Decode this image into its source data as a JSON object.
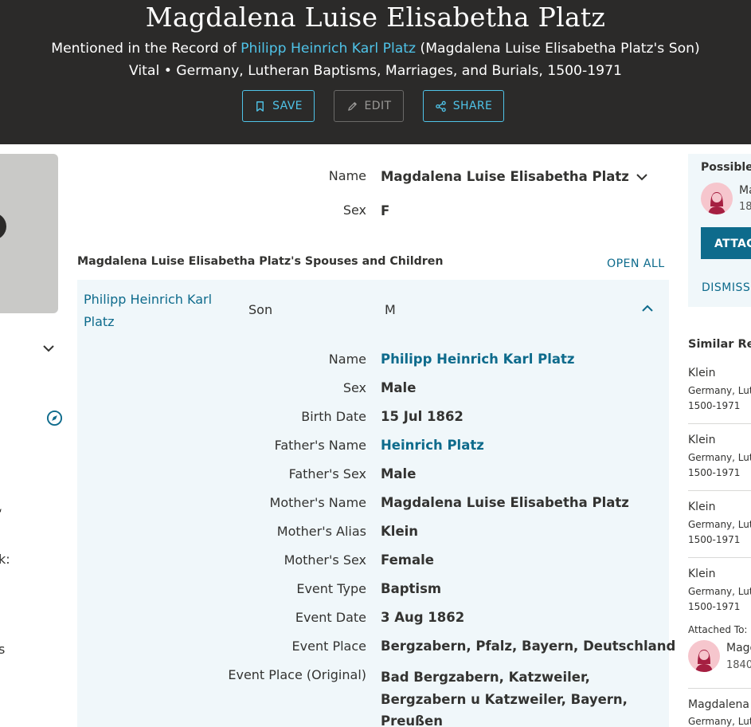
{
  "hero": {
    "title": "Magdalena Luise Elisabetha Platz",
    "mention_prefix": "Mentioned in the Record of",
    "mention_link": "Philipp Heinrich Karl Platz",
    "mention_suffix": "(Magdalena Luise Elisabetha Platz's Son)",
    "vital_line": "Vital • Germany, Lutheran Baptisms, Marriages, and Burials, 1500-1971",
    "buttons": {
      "save": "SAVE",
      "edit": "EDIT",
      "share": "SHARE"
    }
  },
  "left_partial": {
    "frag1": "‘",
    "frag2": "k:",
    "frag3": "s"
  },
  "person": {
    "name_label": "Name",
    "name_value": "Magdalena Luise Elisabetha Platz",
    "sex_label": "Sex",
    "sex_value": "F"
  },
  "family": {
    "section_title": "Magdalena Luise Elisabetha Platz's Spouses and Children",
    "open_all": "OPEN ALL",
    "relative": {
      "name": "Philipp Heinrich Karl Platz",
      "role": "Son",
      "sex": "M",
      "details": [
        {
          "label": "Name",
          "value": "Philipp Heinrich Karl Platz"
        },
        {
          "label": "Sex",
          "value": "Male"
        },
        {
          "label": "Birth Date",
          "value": "15 Jul 1862"
        },
        {
          "label": "Father's Name",
          "value": "Heinrich Platz"
        },
        {
          "label": "Father's Sex",
          "value": "Male"
        },
        {
          "label": "Mother's Name",
          "value": "Magdalena Luise Elisabetha Platz"
        },
        {
          "label": "Mother's Alias",
          "value": "Klein"
        },
        {
          "label": "Mother's Sex",
          "value": "Female"
        },
        {
          "label": "Event Type",
          "value": "Baptism"
        },
        {
          "label": "Event Date",
          "value": "3 Aug 1862"
        },
        {
          "label": "Event Place",
          "value": "Bergzabern, Pfalz, Bayern, Deutschland"
        },
        {
          "label": "Event Place (Original)",
          "value": "Bad Bergzabern, Katzweiler, Bergzabern u Katzweiler, Bayern, Preußen"
        }
      ]
    }
  },
  "possible_match": {
    "title": "Possible",
    "name": "Ma",
    "years": "18",
    "attach": "ATTACH",
    "dismiss": "DISMISS"
  },
  "similar": {
    "title": "Similar Re",
    "items": [
      {
        "name": "Klein",
        "line1": "Germany, Lut",
        "line2": "1500-1971"
      },
      {
        "name": "Klein",
        "line1": "Germany, Lut",
        "line2": "1500-1971"
      },
      {
        "name": "Klein",
        "line1": "Germany, Lut",
        "line2": "1500-1971"
      },
      {
        "name": "Klein",
        "line1": "Germany, Lut",
        "line2": "1500-1971"
      },
      {
        "name": "Magdalena",
        "line1": "Germany, Lut",
        "line2": ""
      }
    ],
    "attached_to": "Attached To:",
    "attached_name": "Magd",
    "attached_years": "1840"
  },
  "colors": {
    "header_bg": "#2b2a29",
    "link": "#0e6b8c",
    "hero_link": "#4fc3e8",
    "panel_bg": "#f0f7fa",
    "attach_bg": "#0e6b8c"
  }
}
